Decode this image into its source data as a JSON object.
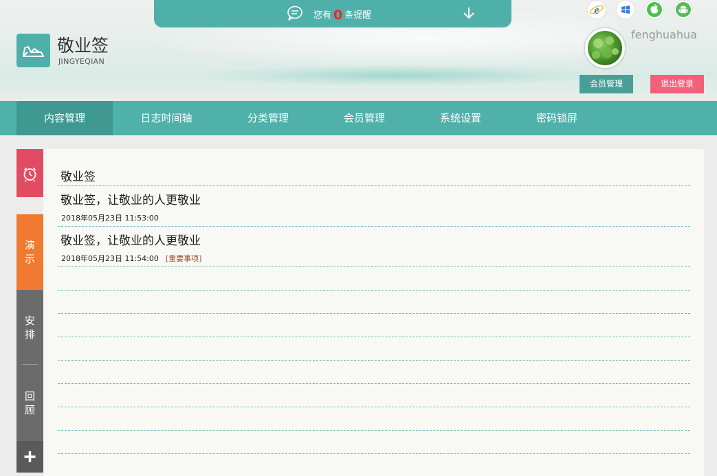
{
  "notify": {
    "prefix": "您有",
    "count": "0",
    "suffix": "条提醒"
  },
  "logo": {
    "title": "敬业签",
    "subtitle": "JINGYEQIAN"
  },
  "user": {
    "name": "fenghuahua",
    "member_button": "会员管理",
    "logout_button": "退出登录"
  },
  "platforms": [
    "ie-icon",
    "windows-icon",
    "apple-icon",
    "android-icon"
  ],
  "nav": [
    {
      "label": "内容管理",
      "active": true
    },
    {
      "label": "日志时间轴",
      "active": false
    },
    {
      "label": "分类管理",
      "active": false
    },
    {
      "label": "会员管理",
      "active": false
    },
    {
      "label": "系统设置",
      "active": false
    },
    {
      "label": "密码锁屏",
      "active": false
    }
  ],
  "side": {
    "demo": [
      "演",
      "示"
    ],
    "arrange": [
      "安",
      "排"
    ],
    "review": [
      "回",
      "顾"
    ]
  },
  "notes": {
    "header": "敬业签",
    "entries": [
      {
        "title": "敬业签，让敬业的人更敬业",
        "date": "2018年05月23日 11:53:00",
        "tag": ""
      },
      {
        "title": "敬业签，让敬业的人更敬业",
        "date": "2018年05月23日 11:54:00",
        "tag": "[重要事项]"
      }
    ]
  },
  "colors": {
    "accent": "#50b0aa",
    "nav_active": "#3f9892",
    "alarm_tab": "#e24c63",
    "demo_tab": "#f07a2f",
    "gray_tab": "#6b6b6b",
    "logout": "#f2607a",
    "count": "#e62828"
  }
}
